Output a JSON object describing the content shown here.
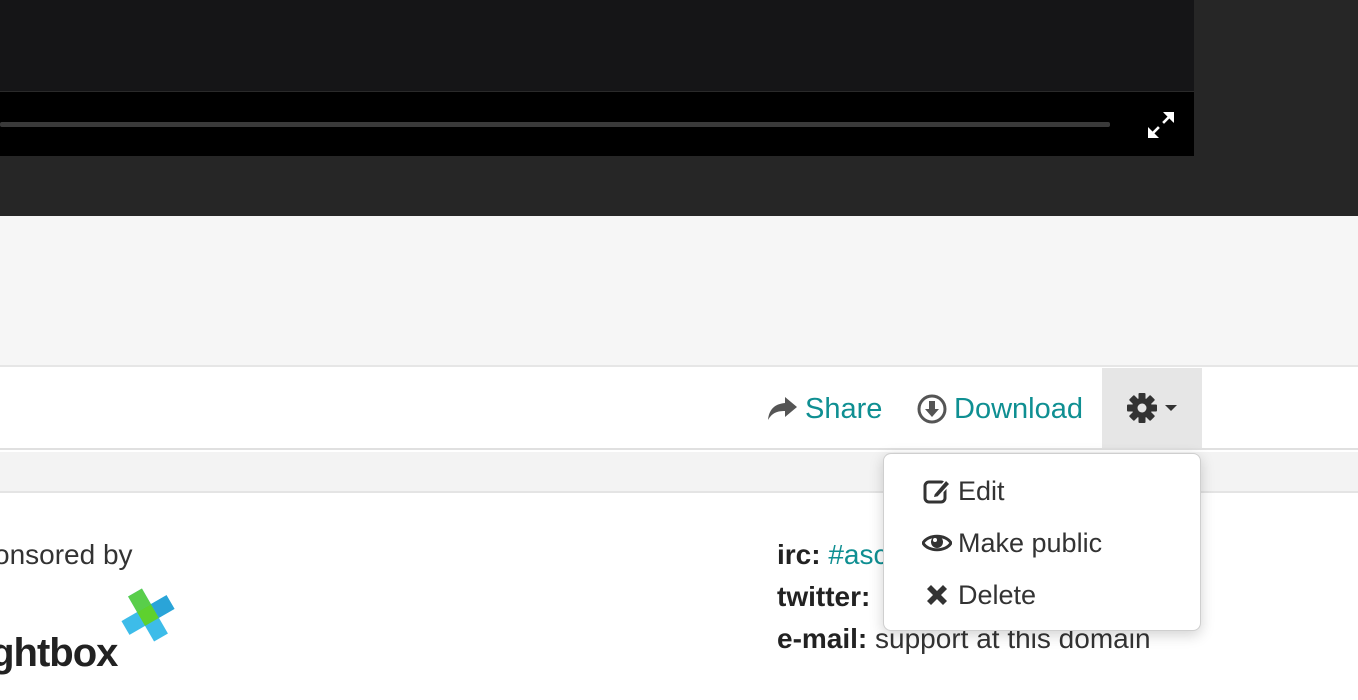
{
  "actions": {
    "share_label": "Share",
    "download_label": "Download"
  },
  "settings_menu": {
    "items": [
      {
        "label": "Edit",
        "icon": "edit-icon"
      },
      {
        "label": "Make public",
        "icon": "eye-icon"
      },
      {
        "label": "Delete",
        "icon": "close-icon"
      }
    ]
  },
  "footer": {
    "sponsored_text": "onsored by",
    "sponsor_logo_text": "ightbox",
    "irc_label": "irc:",
    "irc_value": "#asc",
    "twitter_label": "twitter:",
    "email_label": "e-mail:",
    "email_value": "support at this domain"
  },
  "colors": {
    "accent": "#0f8f92",
    "player_bg": "#262626",
    "control_bar": "#000000"
  }
}
